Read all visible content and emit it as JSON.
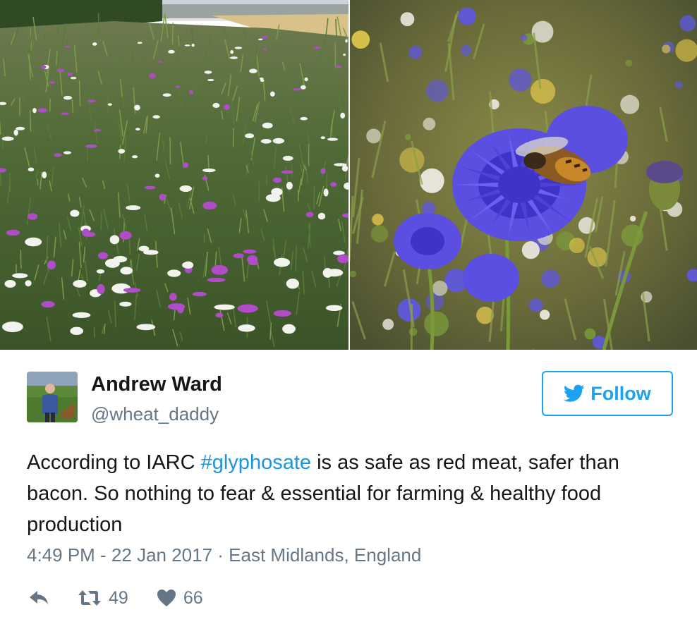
{
  "media": {
    "left_photo": "wildflower-meadow-photo",
    "right_photo": "bee-on-cornflower-photo"
  },
  "author": {
    "name": "Andrew Ward",
    "handle": "@wheat_daddy"
  },
  "follow_button": {
    "label": "Follow",
    "icon": "bird-icon"
  },
  "tweet": {
    "text_before": "According to IARC ",
    "hashtag": "#glyphosate",
    "text_after": " is as safe as red meat, safer than bacon. So nothing to fear & essential for farming & healthy food production"
  },
  "meta": {
    "timestamp": "4:49 PM - 22 Jan 2017",
    "separator": " · ",
    "location": "East Midlands, England"
  },
  "actions": {
    "retweet_count": "49",
    "like_count": "66"
  },
  "colors": {
    "accent": "#1da1f2",
    "hashtag": "#1b95e0",
    "muted": "#657786",
    "text": "#14171a"
  }
}
